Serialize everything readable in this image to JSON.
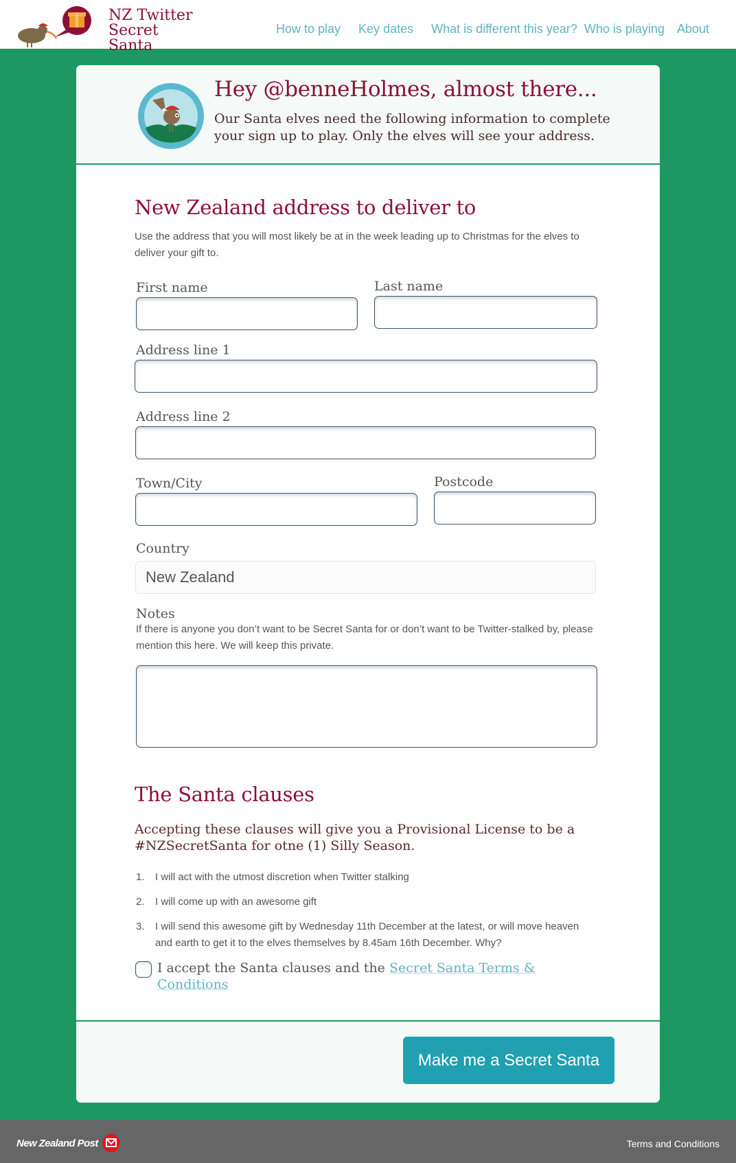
{
  "header": {
    "logo_line1": "NZ Twitter",
    "logo_line2": "Secret Santa",
    "nav": [
      "How to play",
      "Key dates",
      "What is different this year?",
      "Who is playing",
      "About"
    ]
  },
  "greeting": {
    "title": "Hey @benneHolmes, almost there...",
    "body": "Our Santa elves need the following information to complete your sign up to play. Only the elves will see your address."
  },
  "address": {
    "heading": "New Zealand address to deliver to",
    "description": "Use the address that you will most likely be at in the week leading up to Christmas for the elves to deliver your gift to.",
    "fields": {
      "first_name": {
        "label": "First name",
        "value": ""
      },
      "last_name": {
        "label": "Last name",
        "value": ""
      },
      "address1": {
        "label": "Address line 1",
        "value": ""
      },
      "address2": {
        "label": "Address line 2",
        "value": ""
      },
      "town": {
        "label": "Town/City",
        "value": ""
      },
      "postcode": {
        "label": "Postcode",
        "value": ""
      },
      "country": {
        "label": "Country",
        "value": "New Zealand"
      },
      "notes": {
        "label": "Notes",
        "help": "If there is anyone you don’t want to be Secret Santa for or don’t want to be Twitter-stalked by, please mention this here. We will keep this private.",
        "value": ""
      }
    }
  },
  "clauses": {
    "heading": "The Santa clauses",
    "intro": "Accepting these clauses will give you a Provisional License to be a #NZSecretSanta for otne (1) Silly Season.",
    "items": [
      {
        "num": "1.",
        "text": "I will act with the utmost discretion when Twitter stalking"
      },
      {
        "num": "2.",
        "text": "I will come up with an awesome gift"
      },
      {
        "num": "3.",
        "text": "I will send this awesome gift by Wednesday 11th December at the latest, or will move heaven and earth to get it to the elves themselves by 8.45am 16th December. Why?"
      }
    ],
    "accept_prefix": "I accept the Santa clauses and the ",
    "accept_link": "Secret Santa Terms & Conditions",
    "accepted": false
  },
  "submit_label": "Make me a Secret Santa",
  "footer": {
    "brand": "New Zealand Post",
    "terms": "Terms and Conditions"
  },
  "colors": {
    "brand_green": "#1e9862",
    "crimson": "#8c1033",
    "link_teal": "#5fb4c4",
    "button_teal": "#21a0b1",
    "footer_grey": "#666666"
  }
}
